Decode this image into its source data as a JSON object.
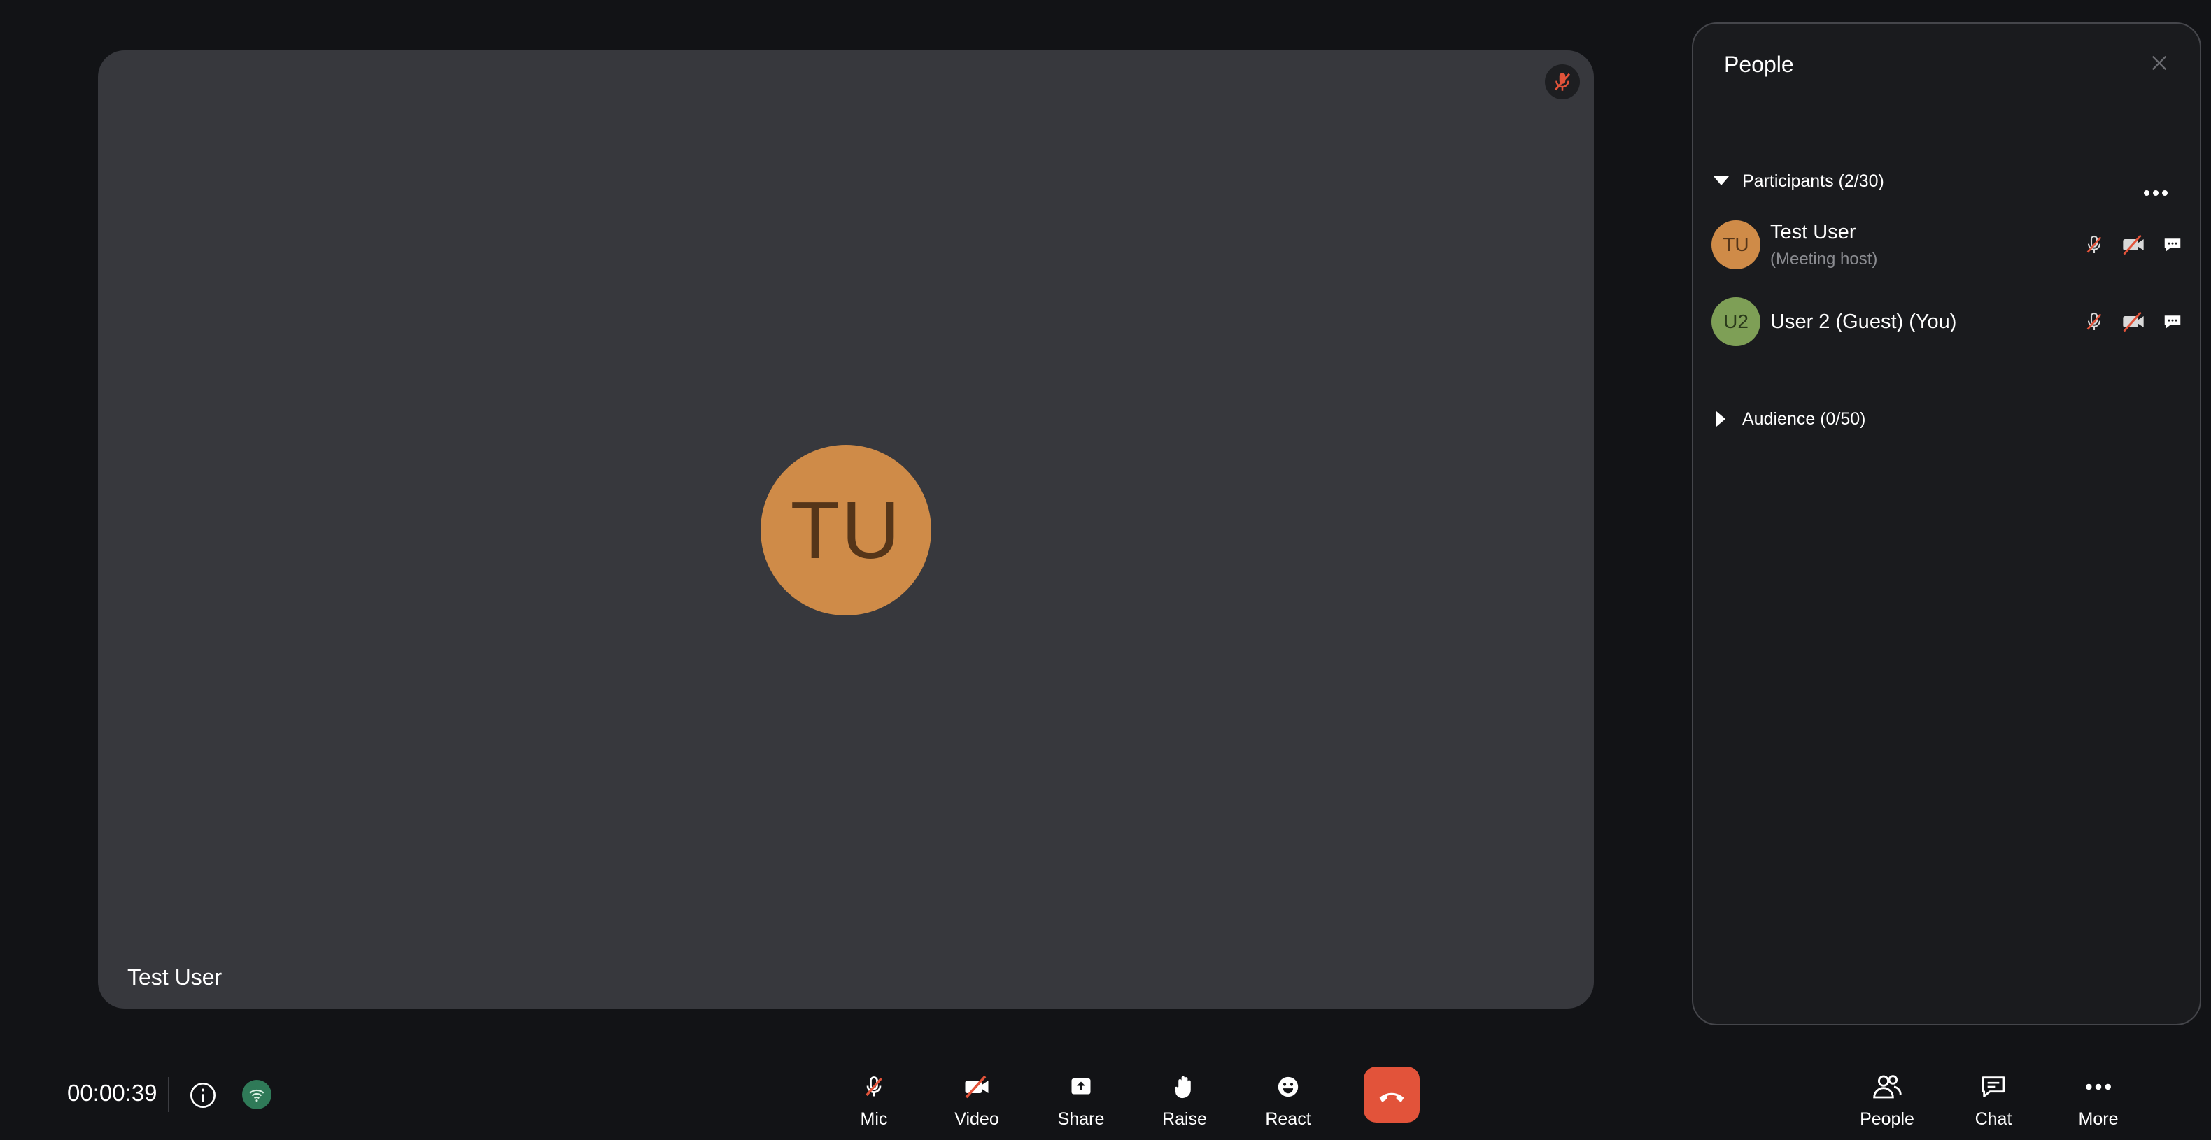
{
  "stage": {
    "tile_name": "Test User",
    "avatar_initials": "TU",
    "avatar_color": "#cf8b48"
  },
  "panel": {
    "title": "People",
    "participants_header": "Participants (2/30)",
    "audience_header": "Audience (0/50)",
    "participants": [
      {
        "initials": "TU",
        "name": "Test User",
        "sub": "(Meeting host)",
        "color": "#cf8b48"
      },
      {
        "initials": "U2",
        "name": "User 2 (Guest) (You)",
        "sub": "",
        "color": "#7e9f56"
      }
    ]
  },
  "bottom_bar": {
    "timer": "00:00:39",
    "controls": {
      "mic": "Mic",
      "video": "Video",
      "share": "Share",
      "raise": "Raise",
      "react": "React"
    },
    "right": {
      "people": "People",
      "chat": "Chat",
      "more": "More"
    }
  },
  "colors": {
    "background": "#121316",
    "stage": "#37383d",
    "end_call": "#e2533a",
    "network_ok": "#2f7a58",
    "muted_red": "#e2533a"
  }
}
